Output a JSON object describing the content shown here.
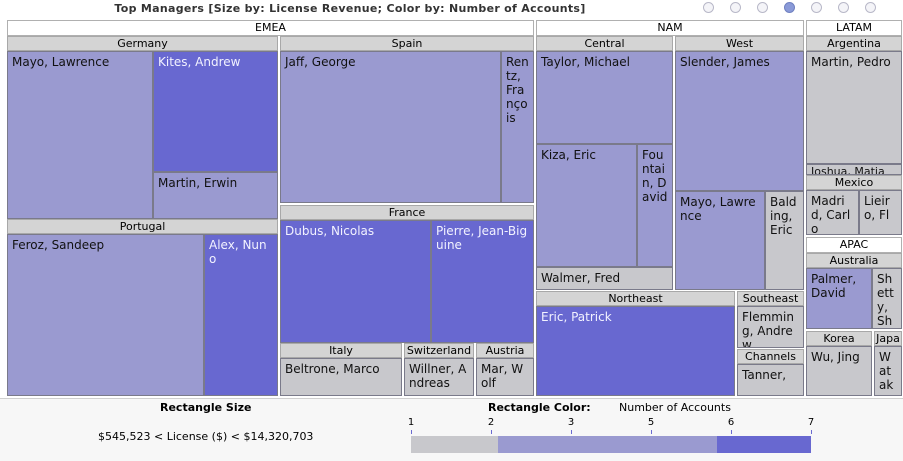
{
  "chart_data": {
    "type": "treemap",
    "title": "Top Managers [Size by: License Revenue; Color by: Number of Accounts]",
    "size_legend": {
      "title": "Rectangle Size",
      "text": "$545,523 < License ($) < $14,320,703"
    },
    "color_legend": {
      "title": "Rectangle Color:",
      "measure": "Number of Accounts",
      "ticks": [
        "1",
        "2",
        "3",
        "5",
        "6",
        "7"
      ],
      "colors": {
        "low": "#c8c8cc",
        "mid": "#9a9ad0",
        "high": "#6868d0"
      }
    },
    "regions": [
      {
        "name": "EMEA",
        "countries": [
          {
            "name": "Germany",
            "managers": [
              "Mayo, Lawrence",
              "Kites, Andrew",
              "Martin, Erwin"
            ]
          },
          {
            "name": "Spain",
            "managers": [
              "Jaff, George",
              "Rentz, François"
            ]
          },
          {
            "name": "Portugal",
            "managers": [
              "Feroz, Sandeep",
              "Alex, Nuno"
            ]
          },
          {
            "name": "France",
            "managers": [
              "Dubus, Nicolas",
              "Pierre, Jean-Biguine"
            ]
          },
          {
            "name": "Italy",
            "managers": [
              "Beltrone, Marco"
            ]
          },
          {
            "name": "Switzerland",
            "managers": [
              "Willner, Andreas"
            ]
          },
          {
            "name": "Austria",
            "managers": [
              "Mar, Wolf"
            ]
          }
        ]
      },
      {
        "name": "NAM",
        "countries": [
          {
            "name": "Central",
            "managers": [
              "Taylor, Michael",
              "Kiza, Eric",
              "Fountain, David",
              "Walmer, Fred"
            ]
          },
          {
            "name": "West",
            "managers": [
              "Slender, James",
              "Mayo, Lawrence",
              "Balding, Eric"
            ]
          },
          {
            "name": "Northeast",
            "managers": [
              "Eric, Patrick"
            ]
          },
          {
            "name": "Southeast",
            "managers": [
              "Flemming, Andrew"
            ]
          },
          {
            "name": "Channels",
            "managers": [
              "Tanner,"
            ]
          }
        ]
      },
      {
        "name": "LATAM",
        "countries": [
          {
            "name": "Argentina",
            "managers": [
              "Martin, Pedro",
              "Joshua, Matia"
            ]
          },
          {
            "name": "Mexico",
            "managers": [
              "Madrid, Carlo",
              "Lieiro, Fl"
            ]
          }
        ]
      },
      {
        "name": "APAC",
        "countries": [
          {
            "name": "Australia",
            "managers": [
              "Palmer, David",
              "Shetty, Sh"
            ]
          },
          {
            "name": "Korea",
            "managers": [
              "Wu, Jing"
            ]
          },
          {
            "name": "Japa",
            "managers": [
              "Watak"
            ]
          }
        ]
      }
    ]
  }
}
